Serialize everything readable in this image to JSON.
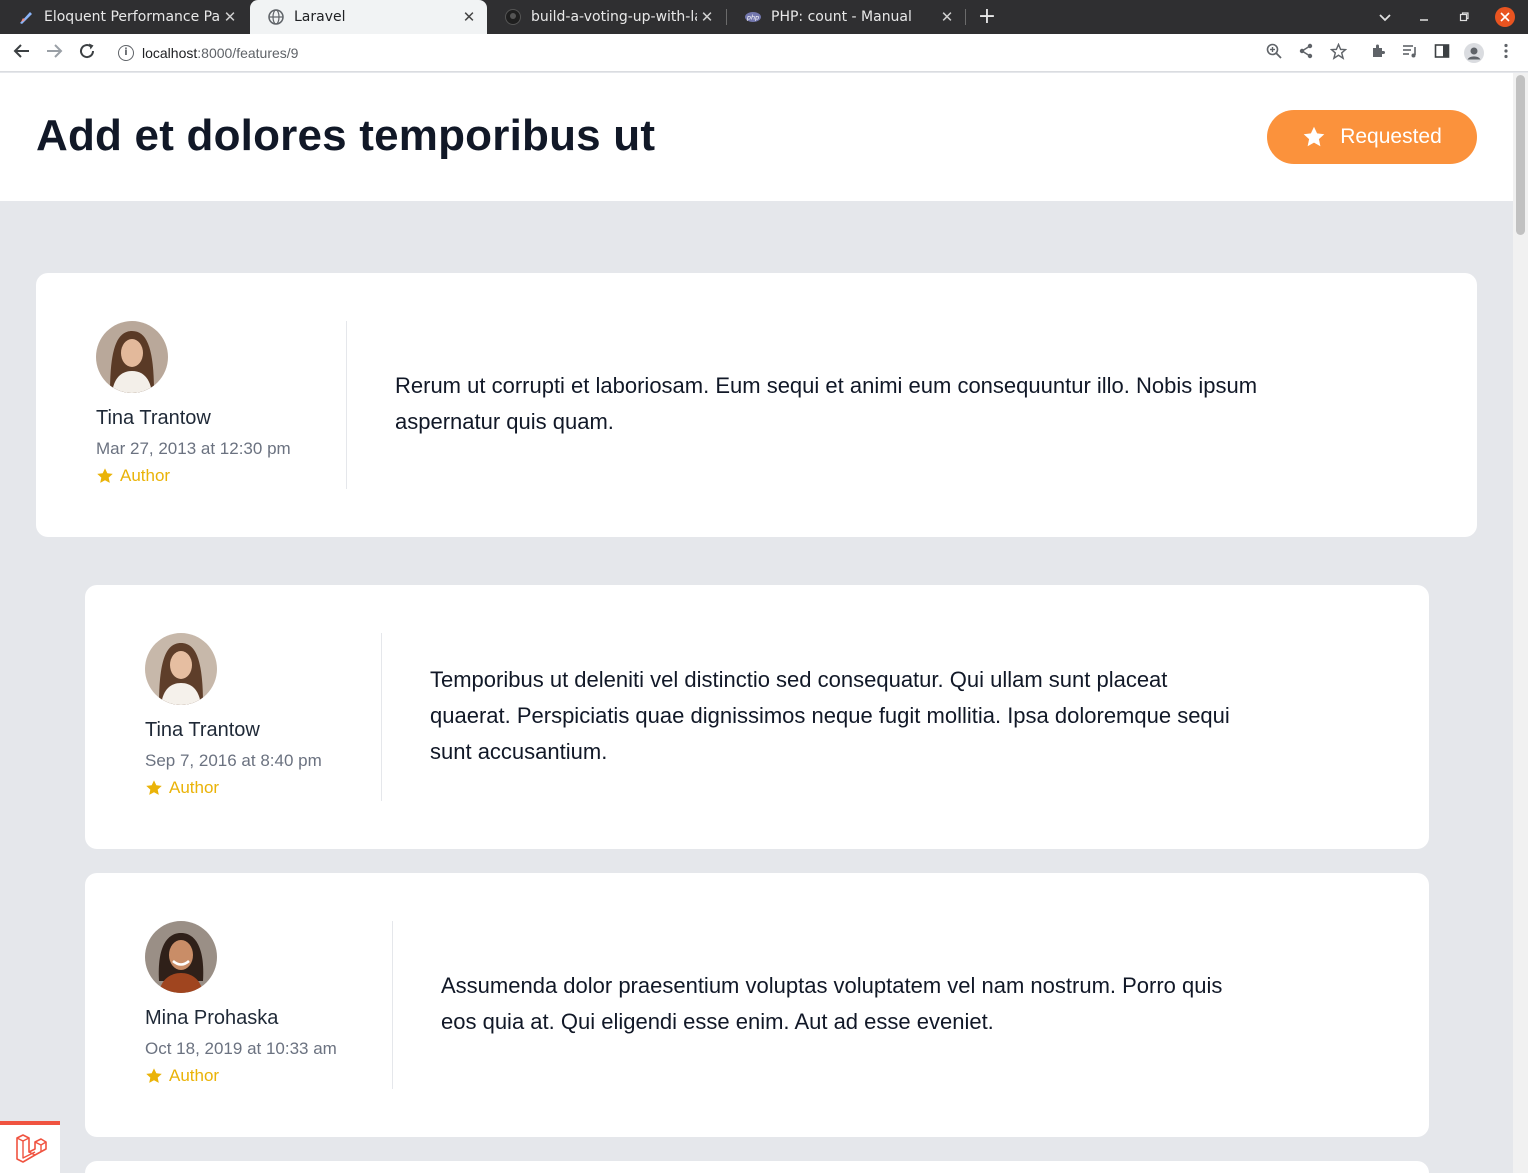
{
  "browser": {
    "tabs": [
      {
        "title": "Eloquent Performance Pa",
        "icon": "eloquent-icon",
        "active": false
      },
      {
        "title": "Laravel",
        "icon": "globe-icon",
        "active": true
      },
      {
        "title": "build-a-voting-up-with-lar",
        "icon": "github-icon",
        "active": false
      },
      {
        "title": "PHP: count - Manual",
        "icon": "php-icon",
        "active": false
      }
    ],
    "close_glyph": "✕",
    "new_tab_glyph": "+",
    "url_host": "localhost",
    "url_path": ":8000/features/9"
  },
  "feature": {
    "title": "Add et dolores temporibus ut",
    "status_label": "Requested",
    "status_color": "#fb923c"
  },
  "comments": [
    {
      "author": "Tina Trantow",
      "date": "Mar 27, 2013 at 12:30 pm",
      "badge": "Author",
      "body_lines": [
        "Rerum ut corrupti et laboriosam. Eum sequi et animi eum consequuntur illo. Nobis ipsum",
        "aspernatur quis quam."
      ]
    },
    {
      "author": "Tina Trantow",
      "date": "Sep 7, 2016 at 8:40 pm",
      "badge": "Author",
      "body_lines": [
        "Temporibus ut deleniti vel distinctio sed consequatur. Qui ullam sunt placeat",
        "quaerat. Perspiciatis quae dignissimos neque fugit mollitia. Ipsa doloremque sequi",
        "sunt accusantium."
      ]
    },
    {
      "author": "Mina Prohaska",
      "date": "Oct 18, 2019 at 10:33 am",
      "badge": "Author",
      "body_lines": [
        "Assumenda dolor praesentium voluptas voluptatem vel nam nostrum. Porro quis",
        "eos quia at. Qui eligendi esse enim. Aut ad esse eveniet."
      ]
    }
  ],
  "colors": {
    "badge": "#eab308",
    "page_bg": "#e5e7eb",
    "debugbar_accent": "#f05340"
  }
}
